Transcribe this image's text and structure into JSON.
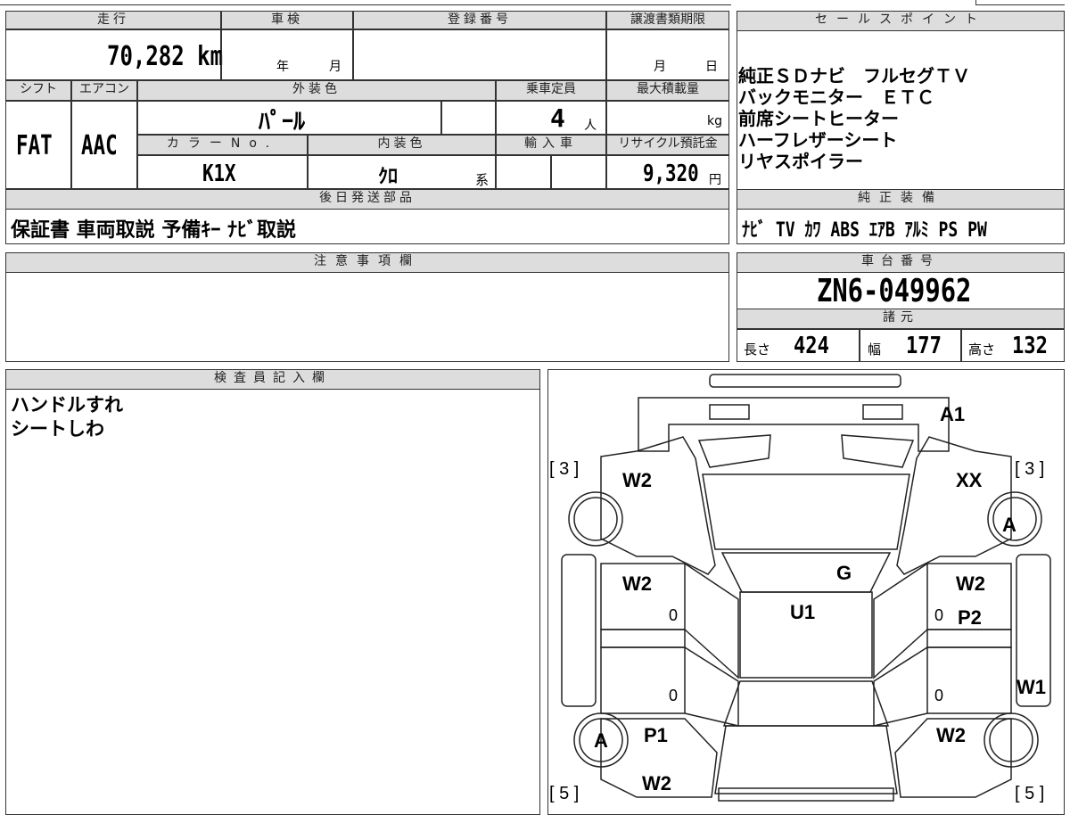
{
  "mileage": {
    "label": "走行",
    "value": "70,282 km"
  },
  "inspection": {
    "label": "車検",
    "year": "年",
    "month": "月"
  },
  "registration": {
    "label": "登録番号"
  },
  "transfer": {
    "label": "譲渡書類期限",
    "month": "月",
    "day": "日"
  },
  "shift": {
    "label": "シフト",
    "value": "FAT"
  },
  "aircon": {
    "label": "エアコン",
    "value": "AAC"
  },
  "exterior_color": {
    "label": "外装色",
    "value": "ﾊﾟｰﾙ"
  },
  "capacity": {
    "label": "乗車定員",
    "value": "4",
    "unit": "人"
  },
  "max_load": {
    "label": "最大積載量",
    "unit": "kg"
  },
  "color_no": {
    "label": "カラーNo.",
    "value": "K1X"
  },
  "interior_color": {
    "label": "内装色",
    "value": "ｸﾛ",
    "suffix": "系"
  },
  "import": {
    "label": "輸入車"
  },
  "recycle": {
    "label": "リサイクル預託金",
    "value": "9,320",
    "unit": "円"
  },
  "sales_points": {
    "label": "セールスポイント",
    "lines": [
      "純正ＳＤナビ　フルセグＴＶ",
      "バックモニター　ＥＴＣ",
      "前席シートヒーター",
      "ハーフレザーシート",
      "リヤスポイラー"
    ]
  },
  "later_parts": {
    "label": "後日発送部品",
    "value": "保証書 車両取説 予備ｷｰ ﾅﾋﾞ取説"
  },
  "equipment": {
    "label": "純正装備",
    "value": "ﾅﾋﾞ TV ｶﾜ ABS ｴｱB ｱﾙﾐ PS PW"
  },
  "notes": {
    "label": "注意事項欄"
  },
  "chassis": {
    "label": "車台番号",
    "value": "ZN6-049962"
  },
  "specs": {
    "label": "諸元",
    "length_label": "長さ",
    "length": "424",
    "width_label": "幅",
    "width": "177",
    "height_label": "高さ",
    "height": "132"
  },
  "inspector": {
    "label": "検査員記入欄",
    "lines": [
      "ハンドルすれ",
      "シートしわ"
    ]
  },
  "diagram": {
    "marks": {
      "a1": "A1",
      "w2_fl": "W2",
      "xx": "XX",
      "a_fr": "A",
      "bracket_3l": "[ 3 ]",
      "bracket_3r": "[ 3 ]",
      "w2_ml": "W2",
      "g": "G",
      "w2_mr": "W2",
      "u1": "U1",
      "p2": "P2",
      "zero1": "0",
      "zero2": "0",
      "zero3": "0",
      "zero4": "0",
      "w1": "W1",
      "a_rl": "A",
      "p1": "P1",
      "w2_rr": "W2",
      "w2_bl": "W2",
      "bracket_5l": "[ 5 ]",
      "bracket_5r": "[ 5 ]"
    }
  }
}
